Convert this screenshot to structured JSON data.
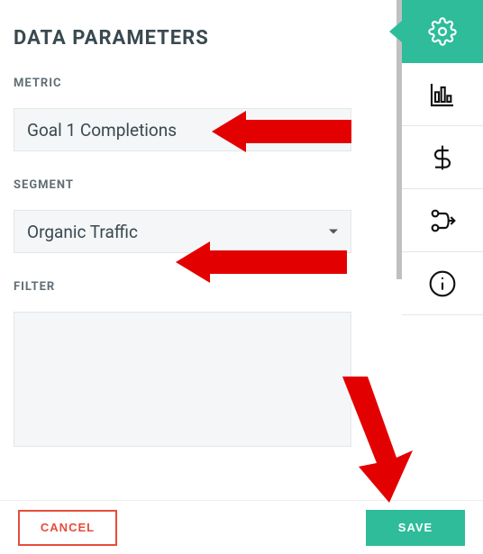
{
  "title": "DATA PARAMETERS",
  "fields": {
    "metric": {
      "label": "METRIC",
      "value": "Goal 1 Completions"
    },
    "segment": {
      "label": "SEGMENT",
      "value": "Organic Traffic"
    },
    "filter": {
      "label": "FILTER"
    }
  },
  "footer": {
    "cancel_label": "CANCEL",
    "save_label": "SAVE"
  },
  "sidebar": {
    "tabs": [
      {
        "name": "settings",
        "active": true
      },
      {
        "name": "chart",
        "active": false
      },
      {
        "name": "dollar",
        "active": false
      },
      {
        "name": "flow",
        "active": false
      },
      {
        "name": "info",
        "active": false
      }
    ]
  },
  "accent_color": "#2ebc9b",
  "danger_color": "#e74c3c"
}
